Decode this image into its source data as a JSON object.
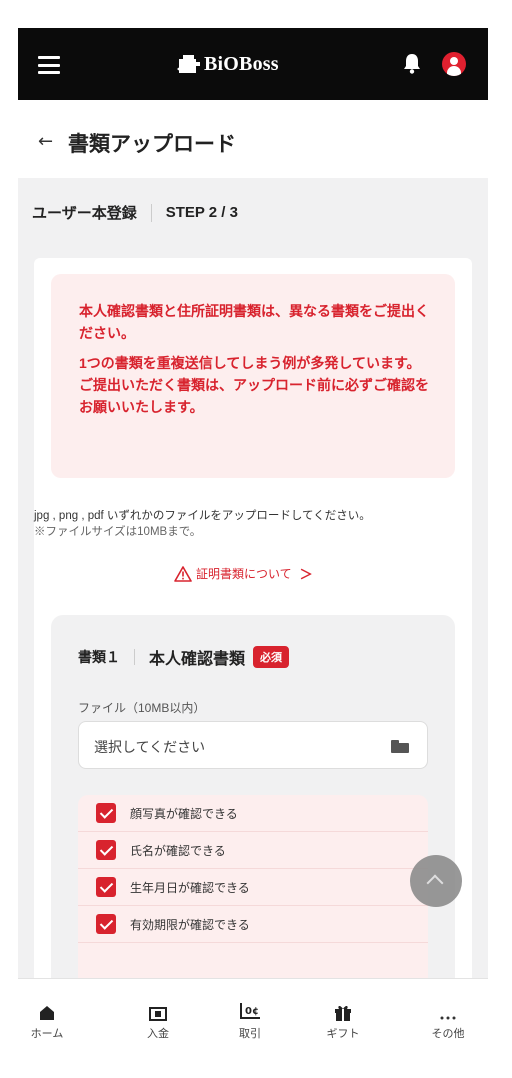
{
  "header": {
    "logo_text": "BiOBoss",
    "icons": [
      "hamburger-icon",
      "bell-icon",
      "user-avatar-icon"
    ]
  },
  "page": {
    "back_icon": "←",
    "title": "書類アップロード"
  },
  "steps": {
    "title": "ユーザー本登録",
    "label": "STEP 2 / 3"
  },
  "alert": {
    "line1": "本人確認書類と住所証明書類は、異なる書類をご提出ください。",
    "line2": "1つの書類を重複送信してしまう例が多発しています。",
    "line3": "ご提出いただく書類は、アップロード前に必ずご確認をお願いいたします。"
  },
  "info": {
    "formats": "jpg , png , pdf いずれかのファイルをアップロードしてください。",
    "size_note": "※ファイルサイズは10MBまで。"
  },
  "doc_link": {
    "label": "証明書類について",
    "chevron": "＞"
  },
  "document": {
    "number": "書類１",
    "type": "本人確認書類",
    "required_badge": "必須",
    "file_label": "ファイル（10MB以内）",
    "file_placeholder": "選択してください",
    "checklist": [
      {
        "label": "顔写真が確認できる",
        "checked": true
      },
      {
        "label": "氏名が確認できる",
        "checked": true
      },
      {
        "label": "生年月日が確認できる",
        "checked": true
      },
      {
        "label": "有効期限が確認できる",
        "checked": true
      }
    ]
  },
  "bottom_nav": [
    {
      "label": "ホーム",
      "icon": "home-icon"
    },
    {
      "label": "入金",
      "icon": "deposit-icon"
    },
    {
      "label": "取引",
      "icon": "trade-icon"
    },
    {
      "label": "ギフト",
      "icon": "gift-icon"
    },
    {
      "label": "その他",
      "icon": "more-icon"
    }
  ],
  "colors": {
    "accent": "#d8232e",
    "header_bg": "#0b0b0b",
    "alert_bg": "#fdeeee"
  }
}
